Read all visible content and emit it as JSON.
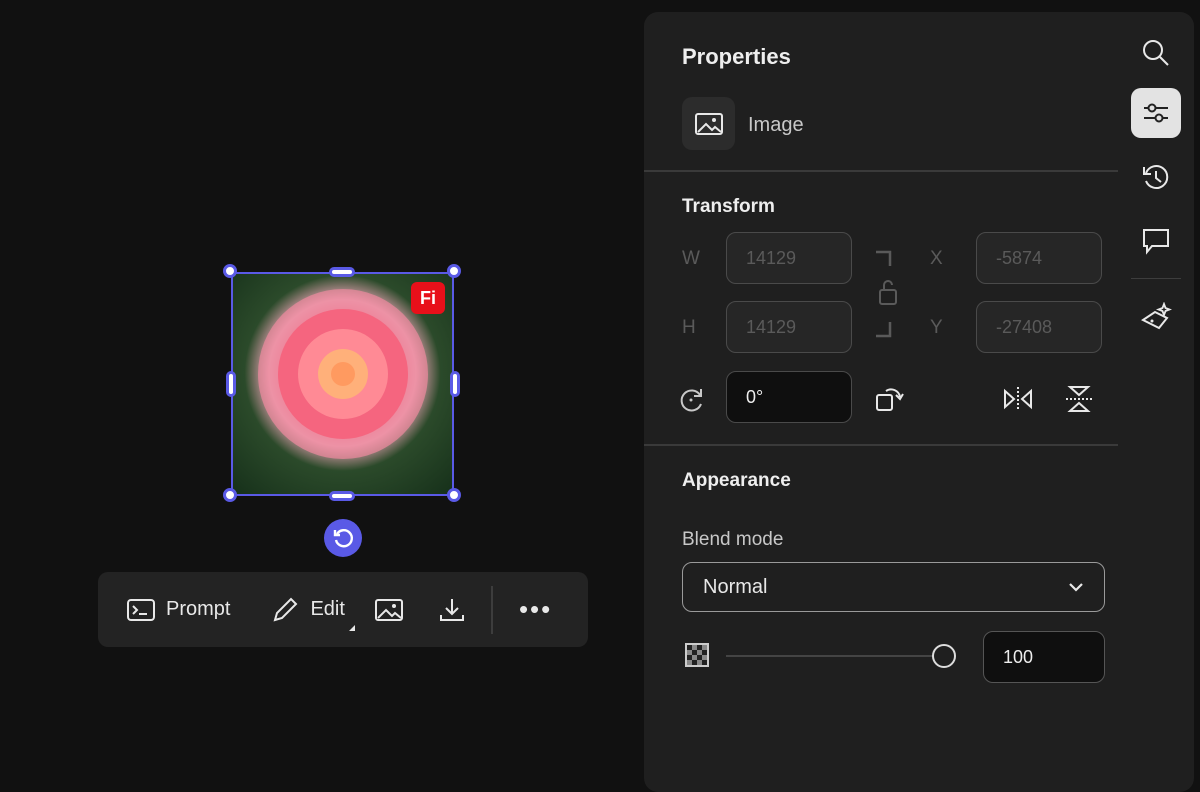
{
  "canvas": {
    "badge": "Fi"
  },
  "toolbar": {
    "prompt": "Prompt",
    "edit": "Edit"
  },
  "panel": {
    "title": "Properties",
    "layer_type": "Image",
    "transform": {
      "title": "Transform",
      "w_label": "W",
      "h_label": "H",
      "x_label": "X",
      "y_label": "Y",
      "w": "14129",
      "h": "14129",
      "x": "-5874",
      "y": "-27408",
      "rotation": "0°"
    },
    "appearance": {
      "title": "Appearance",
      "blend_label": "Blend mode",
      "blend_value": "Normal",
      "opacity": "100",
      "opacity_fraction": 1.0
    }
  },
  "colors": {
    "accent": "#5a5ae6",
    "badge": "#e8101a"
  }
}
